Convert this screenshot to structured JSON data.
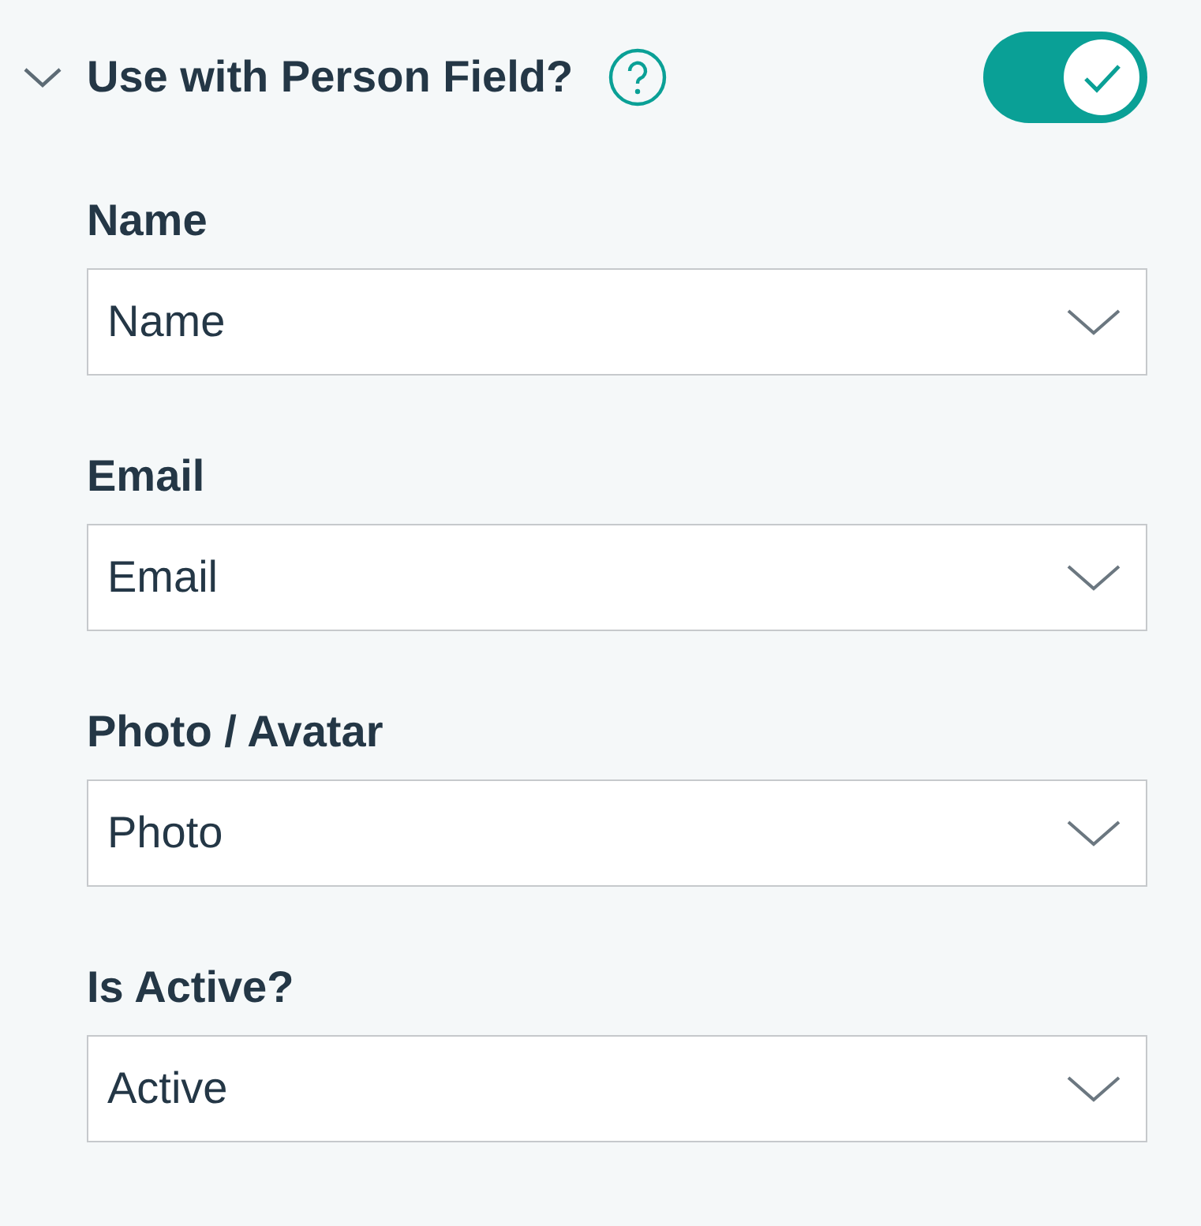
{
  "section": {
    "title": "Use with Person Field?",
    "expanded": true,
    "toggle_on": true
  },
  "fields": [
    {
      "label": "Name",
      "value": "Name"
    },
    {
      "label": "Email",
      "value": "Email"
    },
    {
      "label": "Photo / Avatar",
      "value": "Photo"
    },
    {
      "label": "Is Active?",
      "value": "Active"
    }
  ]
}
